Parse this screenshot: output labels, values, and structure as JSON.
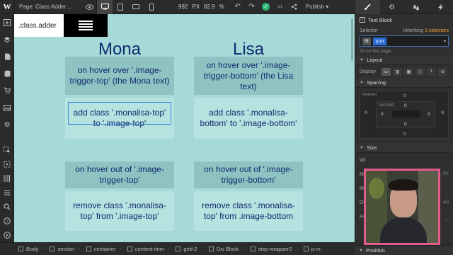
{
  "topbar": {
    "page_label": "Page:",
    "page_name": "Class Adder ...",
    "viewport_width": "992",
    "viewport_unit": "PX",
    "zoom": "82.9",
    "zoom_unit": "%",
    "publish_label": "Publish"
  },
  "canvas": {
    "class_adder_label": ".class.adder",
    "col1_name": "Mona",
    "col2_name": "Lisa",
    "mona_hover": "on hover over '.image-trigger-top' (the Mona text)",
    "lisa_hover": "on hover over '.image-trigger-bottom' (the Lisa text)",
    "mona_add": "add class '.monalisa-top' to '.image-top'",
    "lisa_add": "add class '.monalisa-bottom' to '.image-bottom'",
    "mona_out": "on hover out of '.image-trigger-top'",
    "lisa_out": "on hover out of '.image-trigger-bottom'",
    "mona_remove": "remove class '.monalisa-top' from '.image-top'",
    "lisa_remove": "remove class '.monalisa-top' from .image-bottom",
    "background_color": "#a5dad8",
    "text_color": "#112a6f"
  },
  "panel": {
    "element_type": "Text Block",
    "selector_label": "Selector",
    "inheriting_prefix": "Inheriting",
    "inheriting_count": "3 selectors",
    "selector_tag": "p-m",
    "on_page": "33 on this page",
    "layout_header": "Layout",
    "display_label": "Display",
    "spacing_header": "Spacing",
    "margin_label": "MARGIN",
    "padding_label": "PADDING",
    "margin_top": "0",
    "margin_left": "0",
    "margin_right": "0",
    "margin_bottom": "0",
    "padding_top": "0",
    "padding_left": "0",
    "padding_right": "0",
    "padding_bottom": "0",
    "size_header": "Size",
    "size_w": "Wi",
    "size_min": "Mi",
    "size_max": "Ma",
    "size_overflow": "Ov",
    "size_fit": "Fit",
    "unit_px": "PX",
    "overflow_value": "uto",
    "position_header": "Position",
    "accent_color": "#e7a03b",
    "selector_color": "#2d6fd6"
  },
  "breadcrumb": [
    "Body",
    "section",
    "container",
    "content-item",
    "grid-2",
    "Div Block",
    "step-wrapper2",
    "p-m"
  ]
}
